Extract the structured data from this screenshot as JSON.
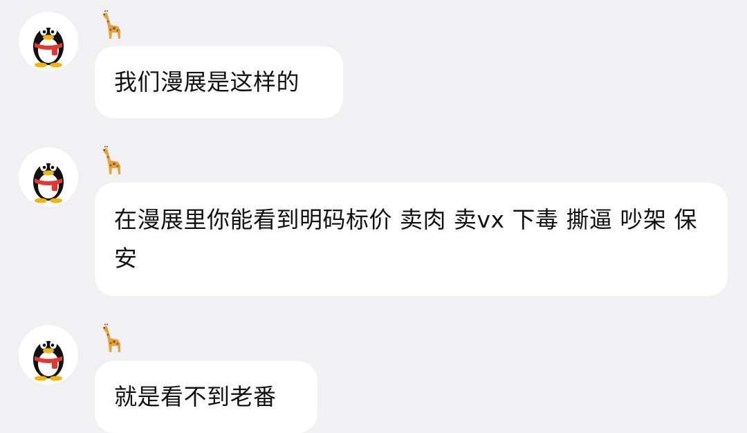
{
  "messages": [
    {
      "avatar_icon": "qq-penguin-avatar-icon",
      "nickname_icon": "giraffe-emoji-icon",
      "text": "我们漫展是这样的"
    },
    {
      "avatar_icon": "qq-penguin-avatar-icon",
      "nickname_icon": "giraffe-emoji-icon",
      "text": "在漫展里你能看到明码标价 卖肉 卖vx 下毒 撕逼 吵架 保安"
    },
    {
      "avatar_icon": "qq-penguin-avatar-icon",
      "nickname_icon": "giraffe-emoji-icon",
      "text": "就是看不到老番"
    }
  ],
  "colors": {
    "background": "#f1f1f4",
    "bubble": "#ffffff",
    "text": "#111111",
    "scarf": "#e8362f",
    "beak": "#f5b400"
  }
}
